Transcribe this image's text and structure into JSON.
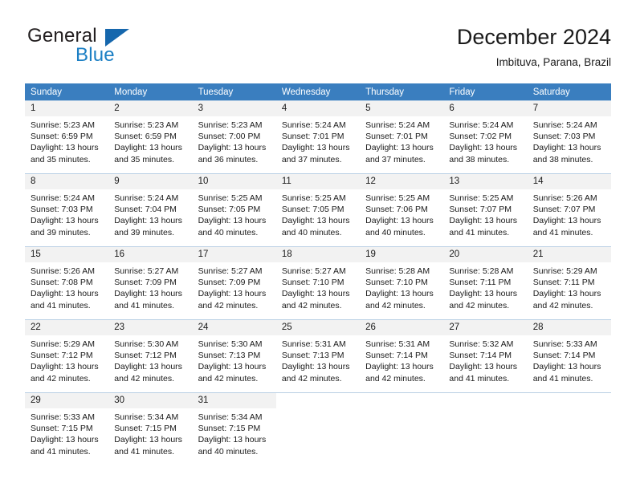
{
  "brand": {
    "name_part1": "General",
    "name_part2": "Blue",
    "triangle_color": "#1667ad",
    "blue_color": "#1b7fc4"
  },
  "header": {
    "title": "December 2024",
    "subtitle": "Imbituva, Parana, Brazil"
  },
  "theme": {
    "header_row_bg": "#3a7ebf",
    "daynum_bg": "#f2f2f2",
    "grid_line": "#b9cfe4"
  },
  "weekday_headers": [
    "Sunday",
    "Monday",
    "Tuesday",
    "Wednesday",
    "Thursday",
    "Friday",
    "Saturday"
  ],
  "weeks": [
    [
      {
        "day": "1",
        "sunrise": "Sunrise: 5:23 AM",
        "sunset": "Sunset: 6:59 PM",
        "daylight_line1": "Daylight: 13 hours",
        "daylight_line2": "and 35 minutes."
      },
      {
        "day": "2",
        "sunrise": "Sunrise: 5:23 AM",
        "sunset": "Sunset: 6:59 PM",
        "daylight_line1": "Daylight: 13 hours",
        "daylight_line2": "and 35 minutes."
      },
      {
        "day": "3",
        "sunrise": "Sunrise: 5:23 AM",
        "sunset": "Sunset: 7:00 PM",
        "daylight_line1": "Daylight: 13 hours",
        "daylight_line2": "and 36 minutes."
      },
      {
        "day": "4",
        "sunrise": "Sunrise: 5:24 AM",
        "sunset": "Sunset: 7:01 PM",
        "daylight_line1": "Daylight: 13 hours",
        "daylight_line2": "and 37 minutes."
      },
      {
        "day": "5",
        "sunrise": "Sunrise: 5:24 AM",
        "sunset": "Sunset: 7:01 PM",
        "daylight_line1": "Daylight: 13 hours",
        "daylight_line2": "and 37 minutes."
      },
      {
        "day": "6",
        "sunrise": "Sunrise: 5:24 AM",
        "sunset": "Sunset: 7:02 PM",
        "daylight_line1": "Daylight: 13 hours",
        "daylight_line2": "and 38 minutes."
      },
      {
        "day": "7",
        "sunrise": "Sunrise: 5:24 AM",
        "sunset": "Sunset: 7:03 PM",
        "daylight_line1": "Daylight: 13 hours",
        "daylight_line2": "and 38 minutes."
      }
    ],
    [
      {
        "day": "8",
        "sunrise": "Sunrise: 5:24 AM",
        "sunset": "Sunset: 7:03 PM",
        "daylight_line1": "Daylight: 13 hours",
        "daylight_line2": "and 39 minutes."
      },
      {
        "day": "9",
        "sunrise": "Sunrise: 5:24 AM",
        "sunset": "Sunset: 7:04 PM",
        "daylight_line1": "Daylight: 13 hours",
        "daylight_line2": "and 39 minutes."
      },
      {
        "day": "10",
        "sunrise": "Sunrise: 5:25 AM",
        "sunset": "Sunset: 7:05 PM",
        "daylight_line1": "Daylight: 13 hours",
        "daylight_line2": "and 40 minutes."
      },
      {
        "day": "11",
        "sunrise": "Sunrise: 5:25 AM",
        "sunset": "Sunset: 7:05 PM",
        "daylight_line1": "Daylight: 13 hours",
        "daylight_line2": "and 40 minutes."
      },
      {
        "day": "12",
        "sunrise": "Sunrise: 5:25 AM",
        "sunset": "Sunset: 7:06 PM",
        "daylight_line1": "Daylight: 13 hours",
        "daylight_line2": "and 40 minutes."
      },
      {
        "day": "13",
        "sunrise": "Sunrise: 5:25 AM",
        "sunset": "Sunset: 7:07 PM",
        "daylight_line1": "Daylight: 13 hours",
        "daylight_line2": "and 41 minutes."
      },
      {
        "day": "14",
        "sunrise": "Sunrise: 5:26 AM",
        "sunset": "Sunset: 7:07 PM",
        "daylight_line1": "Daylight: 13 hours",
        "daylight_line2": "and 41 minutes."
      }
    ],
    [
      {
        "day": "15",
        "sunrise": "Sunrise: 5:26 AM",
        "sunset": "Sunset: 7:08 PM",
        "daylight_line1": "Daylight: 13 hours",
        "daylight_line2": "and 41 minutes."
      },
      {
        "day": "16",
        "sunrise": "Sunrise: 5:27 AM",
        "sunset": "Sunset: 7:09 PM",
        "daylight_line1": "Daylight: 13 hours",
        "daylight_line2": "and 41 minutes."
      },
      {
        "day": "17",
        "sunrise": "Sunrise: 5:27 AM",
        "sunset": "Sunset: 7:09 PM",
        "daylight_line1": "Daylight: 13 hours",
        "daylight_line2": "and 42 minutes."
      },
      {
        "day": "18",
        "sunrise": "Sunrise: 5:27 AM",
        "sunset": "Sunset: 7:10 PM",
        "daylight_line1": "Daylight: 13 hours",
        "daylight_line2": "and 42 minutes."
      },
      {
        "day": "19",
        "sunrise": "Sunrise: 5:28 AM",
        "sunset": "Sunset: 7:10 PM",
        "daylight_line1": "Daylight: 13 hours",
        "daylight_line2": "and 42 minutes."
      },
      {
        "day": "20",
        "sunrise": "Sunrise: 5:28 AM",
        "sunset": "Sunset: 7:11 PM",
        "daylight_line1": "Daylight: 13 hours",
        "daylight_line2": "and 42 minutes."
      },
      {
        "day": "21",
        "sunrise": "Sunrise: 5:29 AM",
        "sunset": "Sunset: 7:11 PM",
        "daylight_line1": "Daylight: 13 hours",
        "daylight_line2": "and 42 minutes."
      }
    ],
    [
      {
        "day": "22",
        "sunrise": "Sunrise: 5:29 AM",
        "sunset": "Sunset: 7:12 PM",
        "daylight_line1": "Daylight: 13 hours",
        "daylight_line2": "and 42 minutes."
      },
      {
        "day": "23",
        "sunrise": "Sunrise: 5:30 AM",
        "sunset": "Sunset: 7:12 PM",
        "daylight_line1": "Daylight: 13 hours",
        "daylight_line2": "and 42 minutes."
      },
      {
        "day": "24",
        "sunrise": "Sunrise: 5:30 AM",
        "sunset": "Sunset: 7:13 PM",
        "daylight_line1": "Daylight: 13 hours",
        "daylight_line2": "and 42 minutes."
      },
      {
        "day": "25",
        "sunrise": "Sunrise: 5:31 AM",
        "sunset": "Sunset: 7:13 PM",
        "daylight_line1": "Daylight: 13 hours",
        "daylight_line2": "and 42 minutes."
      },
      {
        "day": "26",
        "sunrise": "Sunrise: 5:31 AM",
        "sunset": "Sunset: 7:14 PM",
        "daylight_line1": "Daylight: 13 hours",
        "daylight_line2": "and 42 minutes."
      },
      {
        "day": "27",
        "sunrise": "Sunrise: 5:32 AM",
        "sunset": "Sunset: 7:14 PM",
        "daylight_line1": "Daylight: 13 hours",
        "daylight_line2": "and 41 minutes."
      },
      {
        "day": "28",
        "sunrise": "Sunrise: 5:33 AM",
        "sunset": "Sunset: 7:14 PM",
        "daylight_line1": "Daylight: 13 hours",
        "daylight_line2": "and 41 minutes."
      }
    ],
    [
      {
        "day": "29",
        "sunrise": "Sunrise: 5:33 AM",
        "sunset": "Sunset: 7:15 PM",
        "daylight_line1": "Daylight: 13 hours",
        "daylight_line2": "and 41 minutes."
      },
      {
        "day": "30",
        "sunrise": "Sunrise: 5:34 AM",
        "sunset": "Sunset: 7:15 PM",
        "daylight_line1": "Daylight: 13 hours",
        "daylight_line2": "and 41 minutes."
      },
      {
        "day": "31",
        "sunrise": "Sunrise: 5:34 AM",
        "sunset": "Sunset: 7:15 PM",
        "daylight_line1": "Daylight: 13 hours",
        "daylight_line2": "and 40 minutes."
      },
      {
        "day": "",
        "sunrise": "",
        "sunset": "",
        "daylight_line1": "",
        "daylight_line2": ""
      },
      {
        "day": "",
        "sunrise": "",
        "sunset": "",
        "daylight_line1": "",
        "daylight_line2": ""
      },
      {
        "day": "",
        "sunrise": "",
        "sunset": "",
        "daylight_line1": "",
        "daylight_line2": ""
      },
      {
        "day": "",
        "sunrise": "",
        "sunset": "",
        "daylight_line1": "",
        "daylight_line2": ""
      }
    ]
  ]
}
